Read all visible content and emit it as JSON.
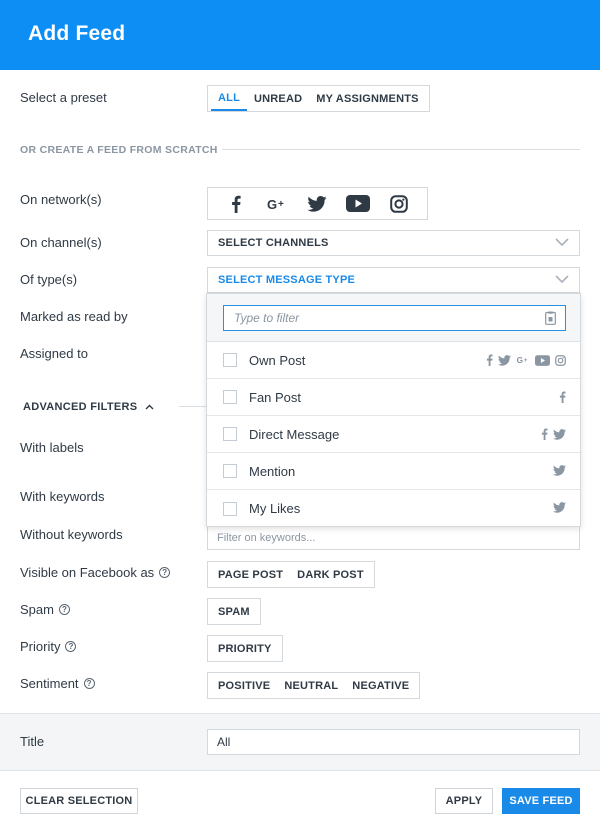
{
  "header": {
    "title": "Add Feed"
  },
  "preset": {
    "label": "Select a preset",
    "options": [
      "ALL",
      "UNREAD",
      "MY ASSIGNMENTS"
    ],
    "active": 0
  },
  "scratch": {
    "heading": "OR CREATE A FEED FROM SCRATCH"
  },
  "network": {
    "label": "On network(s)",
    "icons": [
      "facebook-icon",
      "google-plus-icon",
      "twitter-icon",
      "youtube-icon",
      "instagram-icon"
    ]
  },
  "channel": {
    "label": "On channel(s)",
    "value": "SELECT CHANNELS"
  },
  "type": {
    "label": "Of type(s)",
    "value": "SELECT MESSAGE TYPE"
  },
  "read_by": {
    "label": "Marked as read by"
  },
  "assigned": {
    "label": "Assigned to"
  },
  "dropdown": {
    "filter_placeholder": "Type to filter",
    "items": [
      {
        "label": "Own Post",
        "networks": [
          "facebook",
          "twitter",
          "google-plus",
          "youtube",
          "instagram"
        ]
      },
      {
        "label": "Fan Post",
        "networks": [
          "facebook"
        ]
      },
      {
        "label": "Direct Message",
        "networks": [
          "facebook",
          "twitter"
        ]
      },
      {
        "label": "Mention",
        "networks": [
          "twitter"
        ]
      },
      {
        "label": "My Likes",
        "networks": [
          "twitter"
        ]
      }
    ]
  },
  "advanced": {
    "label": "ADVANCED FILTERS"
  },
  "labels_row": {
    "label": "With labels"
  },
  "keywords": {
    "label": "With keywords"
  },
  "without_keywords": {
    "label": "Without keywords",
    "placeholder": "Filter on keywords..."
  },
  "visible_fb": {
    "label": "Visible on Facebook as",
    "options": [
      "PAGE POST",
      "DARK POST"
    ]
  },
  "spam": {
    "label": "Spam",
    "options": [
      "SPAM"
    ]
  },
  "priority": {
    "label": "Priority",
    "options": [
      "PRIORITY"
    ]
  },
  "sentiment": {
    "label": "Sentiment",
    "options": [
      "POSITIVE",
      "NEUTRAL",
      "NEGATIVE"
    ]
  },
  "title_field": {
    "label": "Title",
    "value": "All"
  },
  "footer": {
    "clear": "CLEAR SELECTION",
    "apply": "APPLY",
    "save": "SAVE FEED"
  },
  "colors": {
    "brand": "#0d8ef5",
    "accent": "#1a8ae8",
    "icon_gray": "#8a96a2",
    "text": "#2f3a45"
  }
}
